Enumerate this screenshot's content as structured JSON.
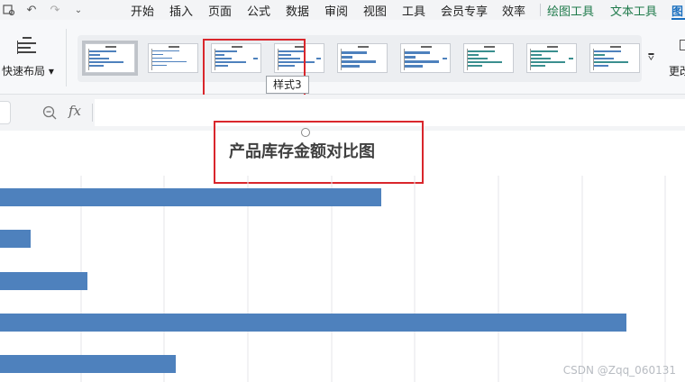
{
  "menu": {
    "tabs": [
      "开始",
      "插入",
      "页面",
      "公式",
      "数据",
      "审阅",
      "视图",
      "工具",
      "会员专享",
      "效率"
    ],
    "context_tabs": [
      "绘图工具",
      "文本工具"
    ],
    "active_tab": "图"
  },
  "ribbon": {
    "quick_layout_label": "快速布局",
    "change_label": "更改",
    "tooltip": "样式3",
    "styles_count": 9
  },
  "formula_bar": {
    "fx_label": "fx",
    "value": ""
  },
  "chart": {
    "title": "产品库存金额对比图"
  },
  "chart_data": {
    "type": "bar",
    "orientation": "horizontal",
    "title": "产品库存金额对比图",
    "series": [
      {
        "values": [
          423,
          34,
          97,
          695,
          195
        ]
      }
    ],
    "xlim": [
      0,
      760
    ],
    "grid": true,
    "color": "#4e81bd"
  },
  "watermark": "CSDN @Zqq_060131",
  "colors": {
    "bar": "#4e81bd",
    "highlight": "#d9262c",
    "context_tab": "#1f7a4b",
    "active_tab": "#1a6fbf"
  }
}
